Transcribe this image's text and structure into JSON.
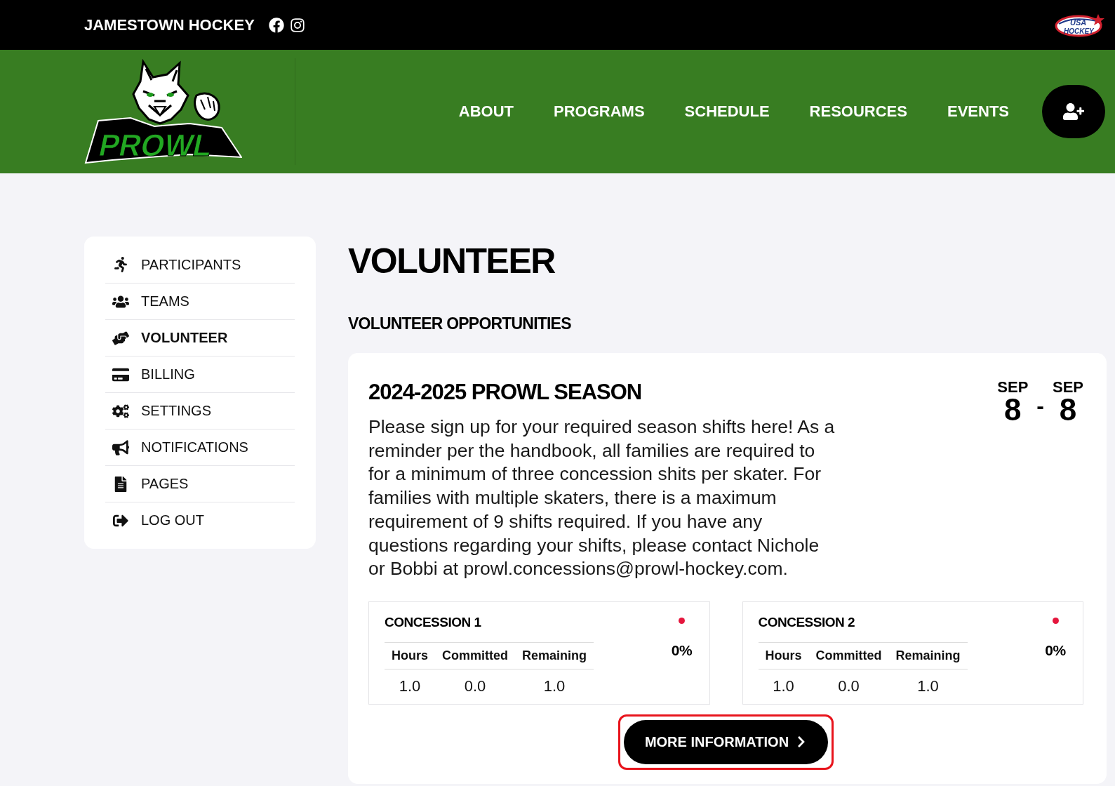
{
  "top_bar": {
    "site_name": "JAMESTOWN HOCKEY",
    "partner_logo": {
      "lines": [
        "USA",
        "HOCKEY"
      ]
    }
  },
  "header": {
    "logo_text": "PROWL",
    "nav": [
      "ABOUT",
      "PROGRAMS",
      "SCHEDULE",
      "RESOURCES",
      "EVENTS"
    ]
  },
  "sidebar": {
    "items": [
      {
        "label": "PARTICIPANTS",
        "selected": false
      },
      {
        "label": "TEAMS",
        "selected": false
      },
      {
        "label": "VOLUNTEER",
        "selected": true
      },
      {
        "label": "BILLING",
        "selected": false
      },
      {
        "label": "SETTINGS",
        "selected": false
      },
      {
        "label": "NOTIFICATIONS",
        "selected": false
      },
      {
        "label": "PAGES",
        "selected": false
      },
      {
        "label": "LOG OUT",
        "selected": false
      }
    ]
  },
  "page": {
    "title": "VOLUNTEER",
    "subtitle": "VOLUNTEER OPPORTUNITIES"
  },
  "opportunity": {
    "title": "2024-2025 PROWL SEASON",
    "description": "Please sign up for your required season shifts here! As a reminder per the handbook, all families are required to for a minimum of three concession shits per skater. For families with multiple skaters, there is a maximum requirement of 9 shifts required. If you have any questions regarding your shifts, please contact Nichole or Bobbi at prowl.concessions@prowl-hockey.com.",
    "start": {
      "month": "SEP",
      "day": "8"
    },
    "separator": "-",
    "end": {
      "month": "SEP",
      "day": "8"
    },
    "shifts": [
      {
        "name": "CONCESSION 1",
        "color": "#e5163d",
        "percent": "0%",
        "columns": [
          "Hours",
          "Committed",
          "Remaining"
        ],
        "values": [
          "1.0",
          "0.0",
          "1.0"
        ]
      },
      {
        "name": "CONCESSION 2",
        "color": "#e5163d",
        "percent": "0%",
        "columns": [
          "Hours",
          "Committed",
          "Remaining"
        ],
        "values": [
          "1.0",
          "0.0",
          "1.0"
        ]
      }
    ],
    "button": {
      "label": "MORE INFORMATION",
      "highlighted": true
    }
  }
}
